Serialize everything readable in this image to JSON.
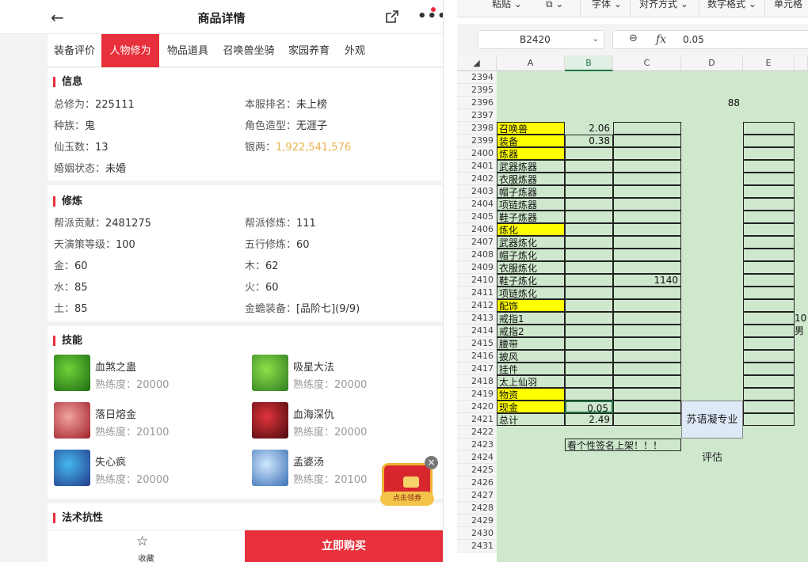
{
  "app": {
    "title": "商品详情",
    "tabs": [
      "装备评价",
      "人物修为",
      "物品道具",
      "召唤兽坐骑",
      "家园养育",
      "外观"
    ],
    "active_tab": "人物修为"
  },
  "info": {
    "section": "信息",
    "rows": [
      {
        "k": "总修为：",
        "v": "225111",
        "k2": "本服排名：",
        "v2": "未上榜"
      },
      {
        "k": "种族：",
        "v": "鬼",
        "k2": "角色造型：",
        "v2": "无涯子"
      },
      {
        "k": "仙玉数：",
        "v": "13",
        "k2": "银两：",
        "v2": "1,922,541,576"
      },
      {
        "k": "婚姻状态：",
        "v": "未婚"
      }
    ]
  },
  "cultivation": {
    "section": "修炼",
    "rows": [
      {
        "k": "帮派贡献：",
        "v": "2481275",
        "k2": "帮派修炼：",
        "v2": "111"
      },
      {
        "k": "天演策等级：",
        "v": "100",
        "k2": "五行修炼：",
        "v2": "60"
      },
      {
        "k": "金：",
        "v": "60",
        "k2": "木：",
        "v2": "62"
      },
      {
        "k": "水：",
        "v": "85",
        "k2": "火：",
        "v2": "60"
      },
      {
        "k": "土：",
        "v": "85",
        "k2": "金蟾装备：",
        "v2": "[品阶七](9/9)"
      }
    ]
  },
  "skills": {
    "section": "技能",
    "items": [
      {
        "name": "血煞之蛊",
        "level": "熟练度：20000",
        "color1": "#6fd23a",
        "color2": "#1d6b12"
      },
      {
        "name": "吸星大法",
        "level": "熟练度：20000",
        "color1": "#8fe04a",
        "color2": "#2e7b20"
      },
      {
        "name": "落日熔金",
        "level": "熟练度：20100",
        "color1": "#f2a3a0",
        "color2": "#a0202a"
      },
      {
        "name": "血海深仇",
        "level": "熟练度：20000",
        "color1": "#e0343a",
        "color2": "#4a0a0e"
      },
      {
        "name": "失心疯",
        "level": "熟练度：20000",
        "color1": "#45b8ef",
        "color2": "#233a8a"
      },
      {
        "name": "孟婆汤",
        "level": "熟练度：20100",
        "color1": "#cfe7ff",
        "color2": "#3a6fb4"
      }
    ]
  },
  "resist": {
    "section": "法术抗性"
  },
  "bottom": {
    "fav": "收藏",
    "buy": "立即购买"
  },
  "coupon": {
    "label": "点击领券",
    "close": "×"
  },
  "excel": {
    "ribbon": [
      "粘贴",
      "字体",
      "对齐方式",
      "数字格式",
      "单元格"
    ],
    "namebox": "B2420",
    "formula_value": "0.05",
    "columns": [
      "A",
      "B",
      "C",
      "D",
      "E"
    ],
    "rows": [
      "2394",
      "2395",
      "2396",
      "2397",
      "2398",
      "2399",
      "2400",
      "2401",
      "2402",
      "2403",
      "2404",
      "2405",
      "2406",
      "2407",
      "2408",
      "2409",
      "2410",
      "2411",
      "2412",
      "2413",
      "2414",
      "2415",
      "2416",
      "2417",
      "2418",
      "2419",
      "2420",
      "2421",
      "2422",
      "2423",
      "2424",
      "2425",
      "2426",
      "2427",
      "2428",
      "2429",
      "2430",
      "2431"
    ],
    "a_cells": [
      "",
      "",
      "",
      "",
      "召唤兽",
      "装备",
      "炼器",
      "武器炼器",
      "衣服炼器",
      "帽子炼器",
      "项链炼器",
      "鞋子炼器",
      "炼化",
      "武器炼化",
      "帽子炼化",
      "衣服炼化",
      "鞋子炼化",
      "项链炼化",
      "配饰",
      "戒指1",
      "戒指2",
      "腰带",
      "披风",
      "挂件",
      "太上仙羽",
      "物资",
      "现金",
      "总计",
      "",
      "",
      "",
      "",
      "",
      "",
      "",
      "",
      "",
      ""
    ],
    "yellow_rows": [
      4,
      5,
      6,
      12,
      18,
      25,
      26
    ],
    "b_values": {
      "4": "2.06",
      "5": "0.38",
      "26": "0.05",
      "27": "2.49"
    },
    "d2396": "88",
    "c2410": "1140",
    "note_2423": "看个性签名上架！！！",
    "eval_label": "苏语凝专业评估",
    "f2413": "10",
    "f2414": "男"
  }
}
